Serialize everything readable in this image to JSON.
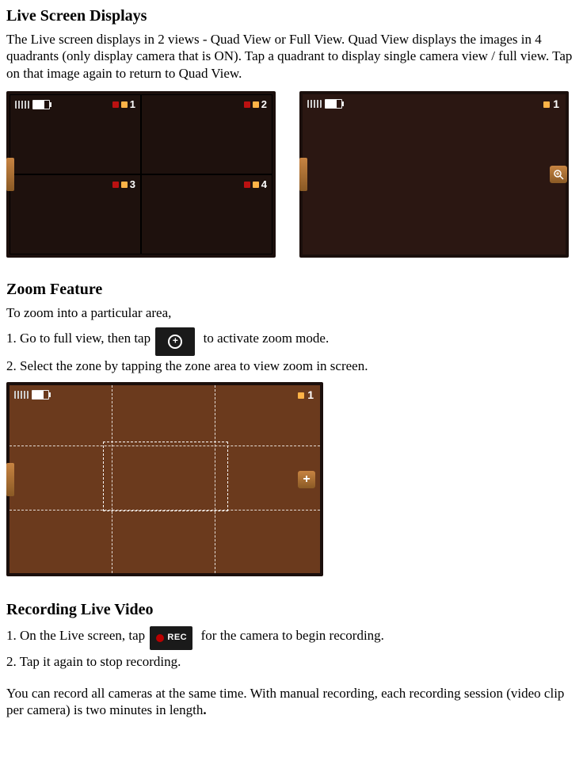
{
  "section1": {
    "heading": "Live Screen Displays",
    "body": "The Live screen displays in 2 views - Quad View or Full View. Quad View displays the images in 4 quadrants (only display camera that is ON). Tap a quadrant to display single camera view / full view. Tap on that image again to return to Quad View."
  },
  "quad_view": {
    "cam1": "1",
    "cam2": "2",
    "cam3": "3",
    "cam4": "4"
  },
  "full_view": {
    "cam_label": "1"
  },
  "section2": {
    "heading": "Zoom Feature",
    "intro": "To zoom into a particular area,",
    "step1_a": "1. Go to full view, then tap",
    "step1_b": " to activate zoom mode.",
    "step2": "2. Select the zone by tapping the zone area to view zoom in screen."
  },
  "zoom_view": {
    "cam_label": "1",
    "plus": "+"
  },
  "section3": {
    "heading": "Recording Live Video",
    "step1_a": "1. On the Live screen, tap ",
    "step1_b": " for the camera to begin recording.",
    "step2": "2. Tap it again to stop recording.",
    "note_a": "You can record all cameras at the same time. With manual recording, each recording session (video clip per camera) is two minutes in length",
    "note_b": "."
  }
}
